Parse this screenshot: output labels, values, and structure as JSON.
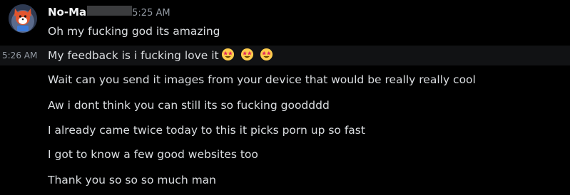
{
  "message": {
    "author": "No-Ma",
    "header_time": "5:25 AM",
    "lines": [
      "Oh my fucking god its amazing",
      "My feedback is i fucking love it",
      "Wait can you send it images from your device that would be really really cool",
      "Aw i dont think you can still its so fucking goodddd",
      "I already came twice today to this it picks porn up so fast",
      "I got to know a few good websites too",
      "Thank you so so so much man"
    ],
    "hover_time": "5:26 AM",
    "emoji_name": "star-struck-emoji",
    "emoji_count": 3
  },
  "colors": {
    "background": "#000000",
    "hover_row": "#111214",
    "text": "#dbdee1",
    "muted": "#949ba4",
    "username": "#f2f3f5"
  }
}
